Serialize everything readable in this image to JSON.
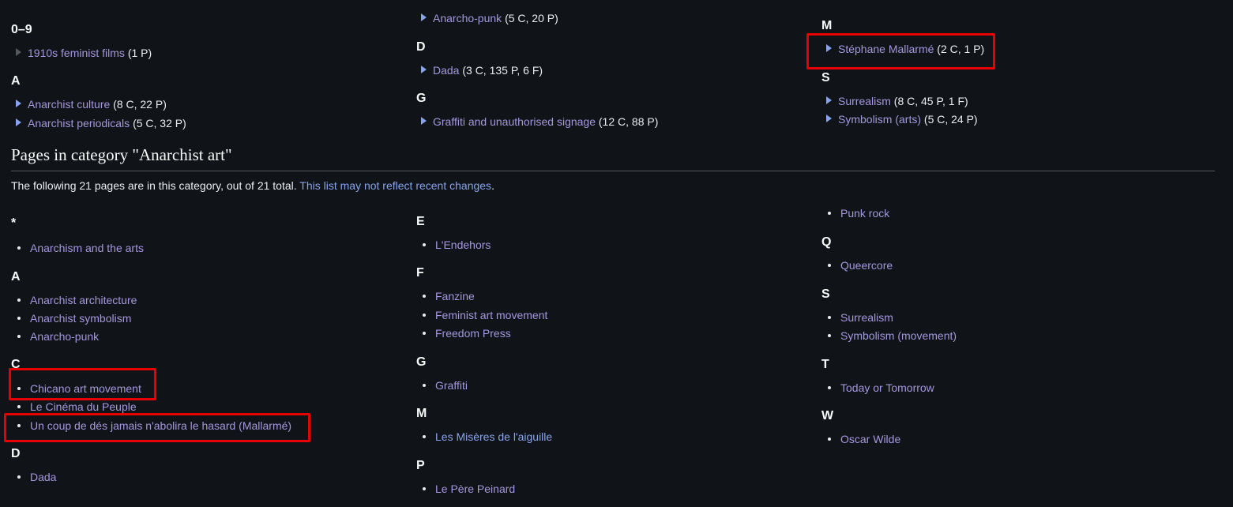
{
  "subcategories": {
    "col1": [
      {
        "letter": "0–9",
        "items": [
          {
            "label": "1910s feminist films",
            "count": "(1 P)",
            "expandable": false
          }
        ]
      },
      {
        "letter": "A",
        "items": [
          {
            "label": "Anarchist culture",
            "count": "(8 C, 22 P)",
            "expandable": true
          },
          {
            "label": "Anarchist periodicals",
            "count": "(5 C, 32 P)",
            "expandable": true
          }
        ]
      }
    ],
    "col2": [
      {
        "letter": "",
        "items": [
          {
            "label": "Anarcho-punk",
            "count": "(5 C, 20 P)",
            "expandable": true
          }
        ]
      },
      {
        "letter": "D",
        "items": [
          {
            "label": "Dada",
            "count": "(3 C, 135 P, 6 F)",
            "expandable": true
          }
        ]
      },
      {
        "letter": "G",
        "items": [
          {
            "label": "Graffiti and unauthorised signage",
            "count": "(12 C, 88 P)",
            "expandable": true
          }
        ]
      }
    ],
    "col3": [
      {
        "letter": "M",
        "items": [
          {
            "label": "Stéphane Mallarmé",
            "count": "(2 C, 1 P)",
            "expandable": true
          }
        ]
      },
      {
        "letter": "S",
        "items": [
          {
            "label": "Surrealism",
            "count": "(8 C, 45 P, 1 F)",
            "expandable": true
          },
          {
            "label": "Symbolism (arts)",
            "count": "(5 C, 24 P)",
            "expandable": true
          }
        ]
      }
    ]
  },
  "pages_heading": "Pages in category \"Anarchist art\"",
  "intro_text": "The following 21 pages are in this category, out of 21 total.",
  "intro_link": "This list may not reflect recent changes",
  "intro_end": ".",
  "pages": {
    "col1": [
      {
        "letter": "*",
        "items": [
          "Anarchism and the arts"
        ]
      },
      {
        "letter": "A",
        "items": [
          "Anarchist architecture",
          "Anarchist symbolism",
          "Anarcho-punk"
        ]
      },
      {
        "letter": "C",
        "items": [
          "Chicano art movement",
          "Le Cinéma du Peuple",
          "Un coup de dés jamais n'abolira le hasard (Mallarmé)"
        ]
      },
      {
        "letter": "D",
        "items": [
          "Dada"
        ]
      }
    ],
    "col2": [
      {
        "letter": "E",
        "items": [
          "L'Endehors"
        ]
      },
      {
        "letter": "F",
        "items": [
          "Fanzine",
          "Feminist art movement",
          "Freedom Press"
        ]
      },
      {
        "letter": "G",
        "items": [
          "Graffiti"
        ]
      },
      {
        "letter": "M",
        "items": [
          "Les Misères de l'aiguille"
        ]
      },
      {
        "letter": "P",
        "items": [
          "Le Père Peinard"
        ]
      }
    ],
    "col3": [
      {
        "letter": "",
        "items": [
          "Punk rock"
        ]
      },
      {
        "letter": "Q",
        "items": [
          "Queercore"
        ]
      },
      {
        "letter": "S",
        "items": [
          "Surrealism",
          "Symbolism (movement)"
        ]
      },
      {
        "letter": "T",
        "items": [
          "Today or Tomorrow"
        ]
      },
      {
        "letter": "W",
        "items": [
          "Oscar Wilde"
        ]
      }
    ]
  },
  "colors": {
    "background": "#101418",
    "link": "#a497dd",
    "highlight": "#e60000"
  }
}
